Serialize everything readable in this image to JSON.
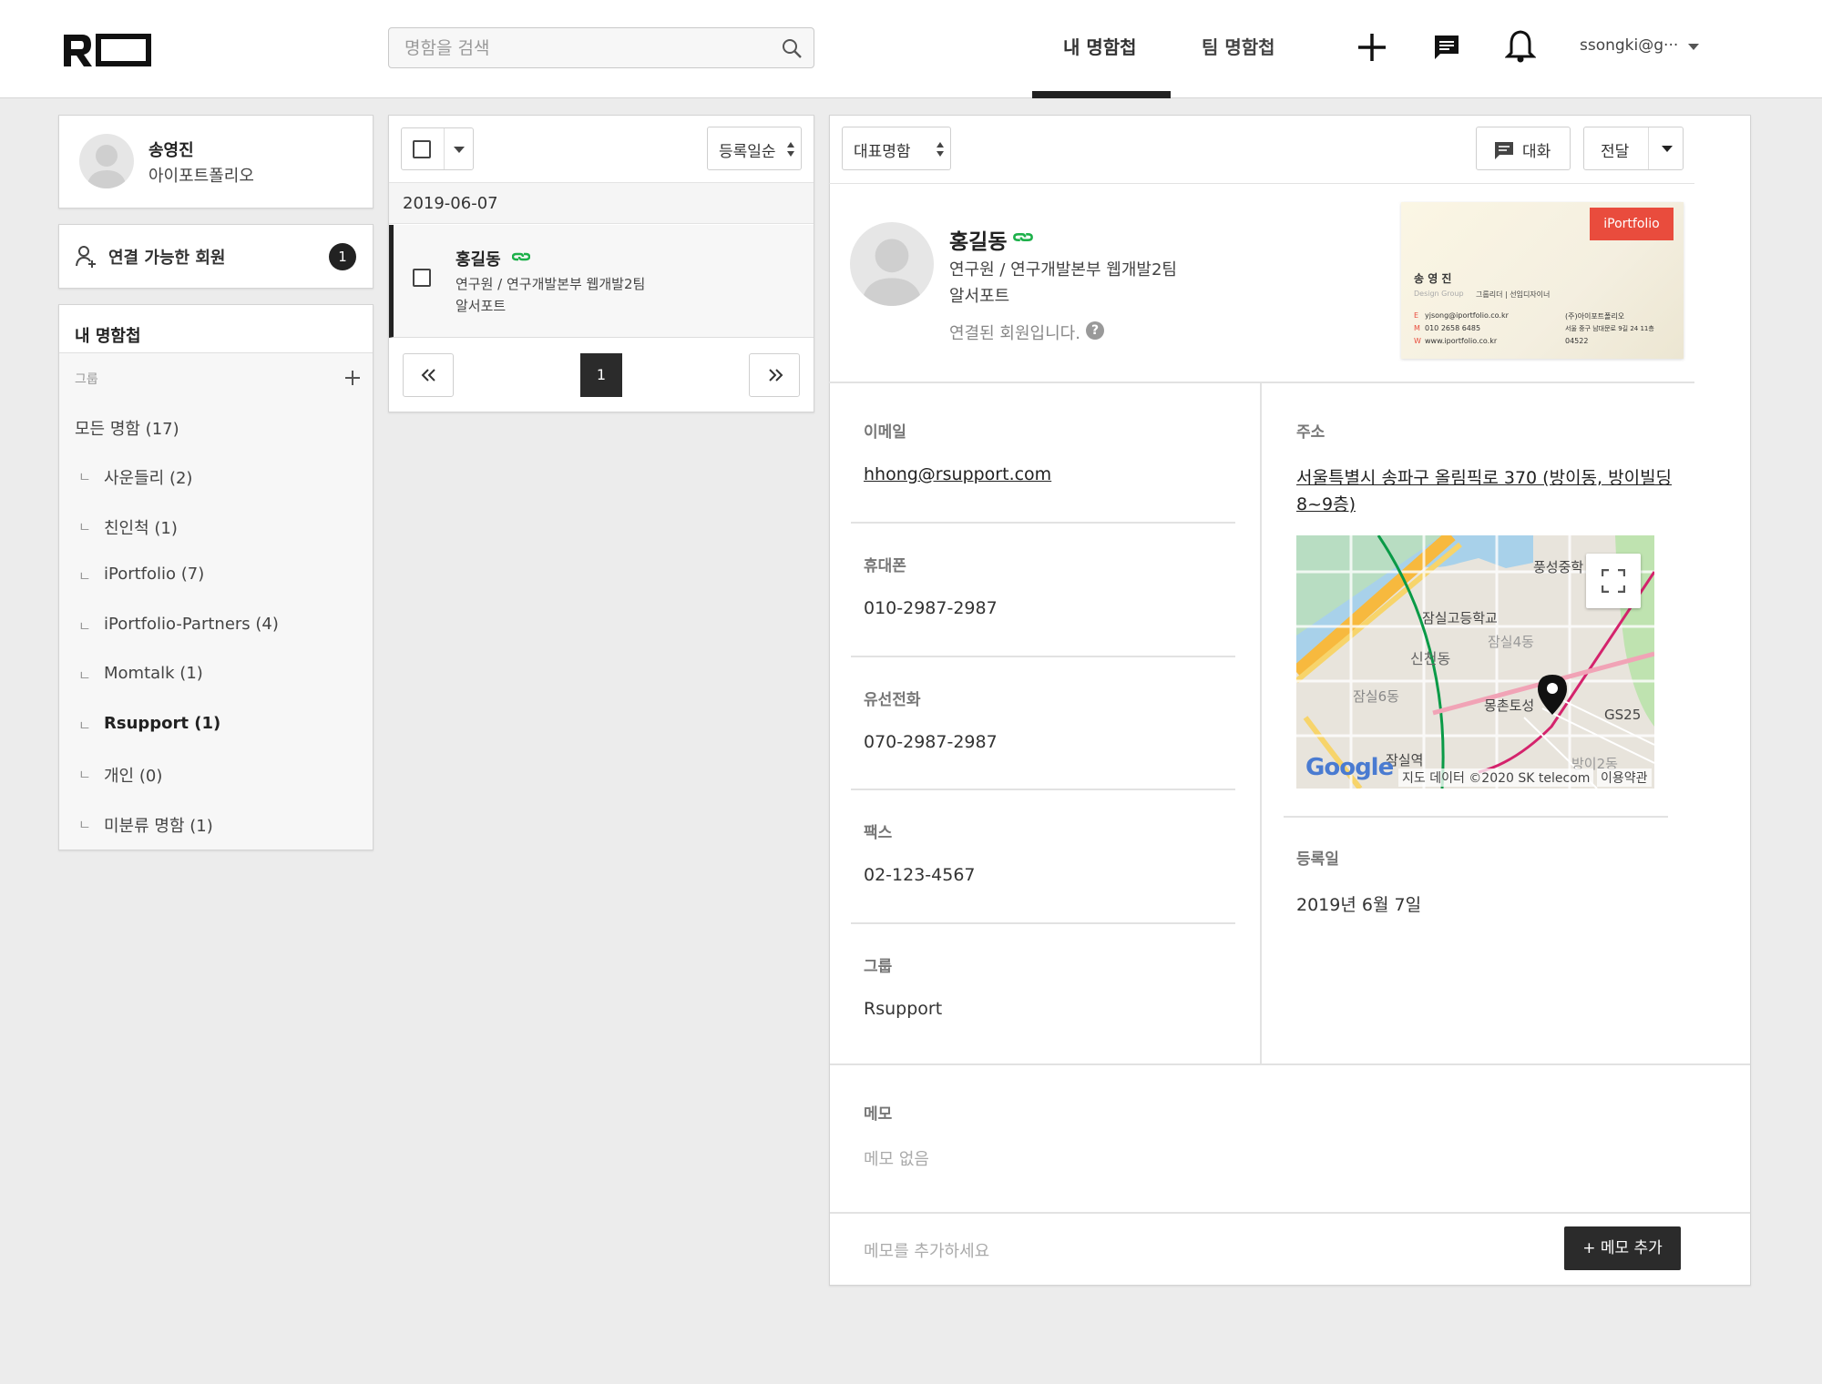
{
  "header": {
    "search_placeholder": "명함을 검색",
    "tabs": [
      {
        "label": "내 명함첩"
      },
      {
        "label": "팀 명함첩"
      }
    ],
    "user_email": "ssongki@g···"
  },
  "profile": {
    "name": "송영진",
    "company": "아이포트폴리오"
  },
  "connect": {
    "label": "연결 가능한 회원",
    "count": "1"
  },
  "book": {
    "title": "내 명함첩",
    "group_label": "그룹",
    "all": "모든 명함  (17)",
    "groups": [
      {
        "name": "사운들리  (2)"
      },
      {
        "name": "친인척  (1)"
      },
      {
        "name": "iPortfolio  (7)"
      },
      {
        "name": "iPortfolio-Partners  (4)"
      },
      {
        "name": "Momtalk  (1)"
      },
      {
        "name": "Rsupport  (1)"
      },
      {
        "name": "개인  (0)"
      },
      {
        "name": "미분류 명함  (1)"
      }
    ],
    "mark": "ㄴ"
  },
  "list": {
    "sort": "등록일순",
    "date": "2019-06-07",
    "item": {
      "name": "홍길동",
      "role": "연구원 / 연구개발본부 웹개발2팀",
      "company": "알서포트"
    },
    "page": "1"
  },
  "detail": {
    "card_select": "대표명함",
    "chat_label": "대화",
    "forward_label": "전달",
    "name": "홍길동",
    "role": "연구원 / 연구개발본부 웹개발2팀",
    "company": "알서포트",
    "connected": "연결된 회원입니다.",
    "biz_card": {
      "brand": "iPortfolio",
      "name": "송 영 진",
      "dept": "Design Group",
      "title": "그룹리더 | 선임디자이너",
      "email": "yjsong@iportfolio.co.kr",
      "phone": "010 2658 6485",
      "web": "www.iportfolio.co.kr",
      "company": "(주)아이포트폴리오",
      "address": "서울 중구 남대문로 9길 24 11층",
      "zip": "04522",
      "prefix_e": "E",
      "prefix_m": "M",
      "prefix_w": "W"
    },
    "email_label": "이메일",
    "email": "hhong@rsupport.com",
    "mobile_label": "휴대폰",
    "mobile": "010-2987-2987",
    "phone_label": "유선전화",
    "phone": "070-2987-2987",
    "fax_label": "팩스",
    "fax": "02-123-4567",
    "group_label": "그룹",
    "group": "Rsupport",
    "address_label": "주소",
    "address_line1": "서울특별시 송파구 올림픽로 370 (방이동, 방이빌딩",
    "address_line2": "8~9층)",
    "reg_label": "등록일",
    "reg_date": "2019년 6월 7일",
    "memo_label": "메모",
    "memo_empty": "메모 없음",
    "memo_placeholder": "메모를 추가하세요",
    "memo_add": "+ 메모 추가"
  },
  "map": {
    "labels": {
      "school": "잠실고등학교",
      "jamsil4": "잠실4동",
      "sincheon": "신천동",
      "jamsil6": "잠실6동",
      "mongchon": "몽촌토성",
      "gs25": "GS25",
      "jamsil_stn": "잠실역",
      "bangi2": "방이2동",
      "pungseong": "풍성중학",
      "google": "Google",
      "attribution": "지도 데이터 ©2020 SK telecom",
      "terms": "이용약관"
    }
  },
  "colors": {
    "accent": "#2b2b2b",
    "link_green": "#1db04a",
    "brand_red": "#e94c3d"
  }
}
